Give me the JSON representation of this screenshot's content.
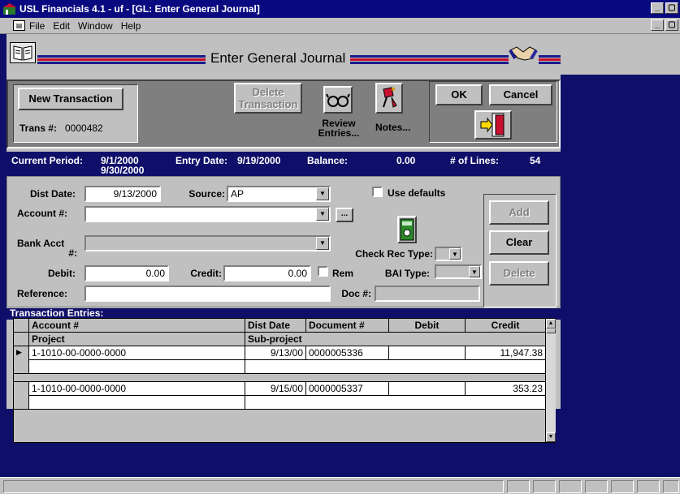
{
  "window": {
    "title": "USL Financials 4.1 - uf - [GL:  Enter General Journal]",
    "controls": {
      "minimize": "_",
      "maximize": "▢",
      "close": "×"
    }
  },
  "menu": {
    "items": [
      "File",
      "Edit",
      "Window",
      "Help"
    ]
  },
  "form": {
    "title": "Enter General Journal",
    "header_colors": {
      "red": "#c8102e",
      "navy": "#1a1a8c"
    }
  },
  "toolbar": {
    "new_transaction": "New Transaction",
    "delete_transaction": "Delete\nTransaction",
    "review_entries": "Review\nEntries...",
    "notes": "Notes...",
    "ok": "OK",
    "cancel": "Cancel",
    "trans_label": "Trans #:",
    "trans_value": "0000482"
  },
  "status": {
    "current_period_label": "Current Period:",
    "period_start": "9/1/2000",
    "period_end": "9/30/2000",
    "entry_date_label": "Entry Date:",
    "entry_date": "9/19/2000",
    "balance_label": "Balance:",
    "balance": "0.00",
    "lines_label": "# of Lines:",
    "lines": "54"
  },
  "entry": {
    "dist_date_label": "Dist Date:",
    "dist_date": "9/13/2000",
    "source_label": "Source:",
    "source": "AP",
    "use_defaults_label": "Use defaults",
    "account_label": "Account #:",
    "account": "",
    "ellipsis": "...",
    "bank_acct_label_1": "Bank Acct",
    "bank_acct_label_2": "#:",
    "check_rec_label": "Check Rec Type:",
    "debit_label": "Debit:",
    "debit": "0.00",
    "credit_label": "Credit:",
    "credit": "0.00",
    "rem_label": "Rem",
    "bai_label": "BAI Type:",
    "reference_label": "Reference:",
    "reference": "",
    "doc_label": "Doc #:",
    "doc": ""
  },
  "side_buttons": {
    "add": "Add",
    "clear": "Clear",
    "delete": "Delete"
  },
  "grid": {
    "caption": "Transaction Entries:",
    "headers": [
      "Account #",
      "Dist Date",
      "Document #",
      "Debit",
      "Credit"
    ],
    "subheaders": [
      "Project",
      "Sub-project"
    ],
    "rows": [
      {
        "account": "1-1010-00-0000-0000",
        "date": "9/13/00",
        "doc": "0000005336",
        "debit": "",
        "credit": "11,947.38"
      },
      {
        "account": "1-1010-00-0000-0000",
        "date": "9/15/00",
        "doc": "0000005337",
        "debit": "",
        "credit": "353.23"
      }
    ]
  }
}
